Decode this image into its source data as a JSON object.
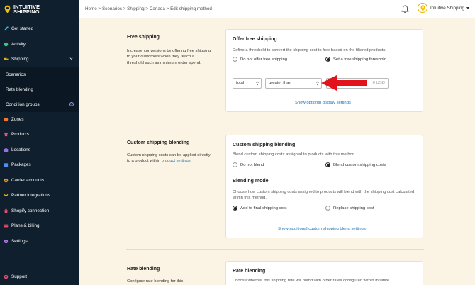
{
  "brand": {
    "name_line1": "INTUITIVE",
    "name_line2": "SHIPPING"
  },
  "sidebar": {
    "items": [
      {
        "label": "Get started",
        "icon": "rocket-icon"
      },
      {
        "label": "Activity",
        "icon": "activity-icon"
      },
      {
        "label": "Shipping",
        "icon": "truck-icon"
      }
    ],
    "subitems": [
      {
        "label": "Scenarios"
      },
      {
        "label": "Rate blending"
      },
      {
        "label": "Condition groups"
      }
    ],
    "items2": [
      {
        "label": "Zones",
        "icon": "zones-icon"
      },
      {
        "label": "Products",
        "icon": "products-icon"
      },
      {
        "label": "Locations",
        "icon": "locations-icon"
      },
      {
        "label": "Packages",
        "icon": "packages-icon"
      },
      {
        "label": "Carrier accounts",
        "icon": "carrier-icon"
      },
      {
        "label": "Partner integrations",
        "icon": "partner-icon"
      },
      {
        "label": "Shopify connection",
        "icon": "shopify-icon"
      },
      {
        "label": "Plans & billing",
        "icon": "billing-icon"
      },
      {
        "label": "Settings",
        "icon": "gear-icon"
      }
    ],
    "support": "Support"
  },
  "topbar": {
    "breadcrumb": "Home > Scenarios > Shipping > Canada > Edit shipping method",
    "account_name": "Intuitive Shipping"
  },
  "free_shipping": {
    "section_title": "Free shipping",
    "section_desc": "Increase conversions by offering free shipping to your customers when they reach a threshold such as minimum order spend.",
    "card_title": "Offer free shipping",
    "card_desc": "Define a threshold to convert the shipping cost to free based on the filtered products.",
    "option_no": "Do not offer free shipping",
    "option_yes": "Set a free shipping threshold",
    "select_field": "total",
    "select_operator": "greater than",
    "amount_suffix": "0 USD",
    "link": "Show optional display settings"
  },
  "custom_blending": {
    "section_title": "Custom shipping blending",
    "section_desc_1": "Custom shipping costs can be applied directly to a product within ",
    "section_desc_link": "product settings",
    "section_desc_2": ".",
    "card_title": "Custom shipping blending",
    "card_desc": "Blend custom shipping costs assigned to products with this method.",
    "option_no": "Do not blend",
    "option_yes": "Blend custom shipping costs",
    "mode_title": "Blending mode",
    "mode_desc": "Choose how custom shipping costs assigned to products will blend with the shipping cost calculated within this method.",
    "mode_add": "Add to final shipping cost",
    "mode_replace": "Replace shipping cost",
    "link": "Show additional custom shipping blend settings"
  },
  "rate_blending": {
    "section_title": "Rate blending",
    "section_desc": "Configure rate blending for this",
    "card_title": "Rate blending",
    "card_desc": "Choose whether this shipping rate will blend with other rates configured within Intuitive"
  },
  "colors": {
    "sidebar_bg": "#0f1f2e",
    "page_bg": "#fbf4e4",
    "link": "#1a73b8",
    "annotation_arrow": "#e3131b"
  }
}
